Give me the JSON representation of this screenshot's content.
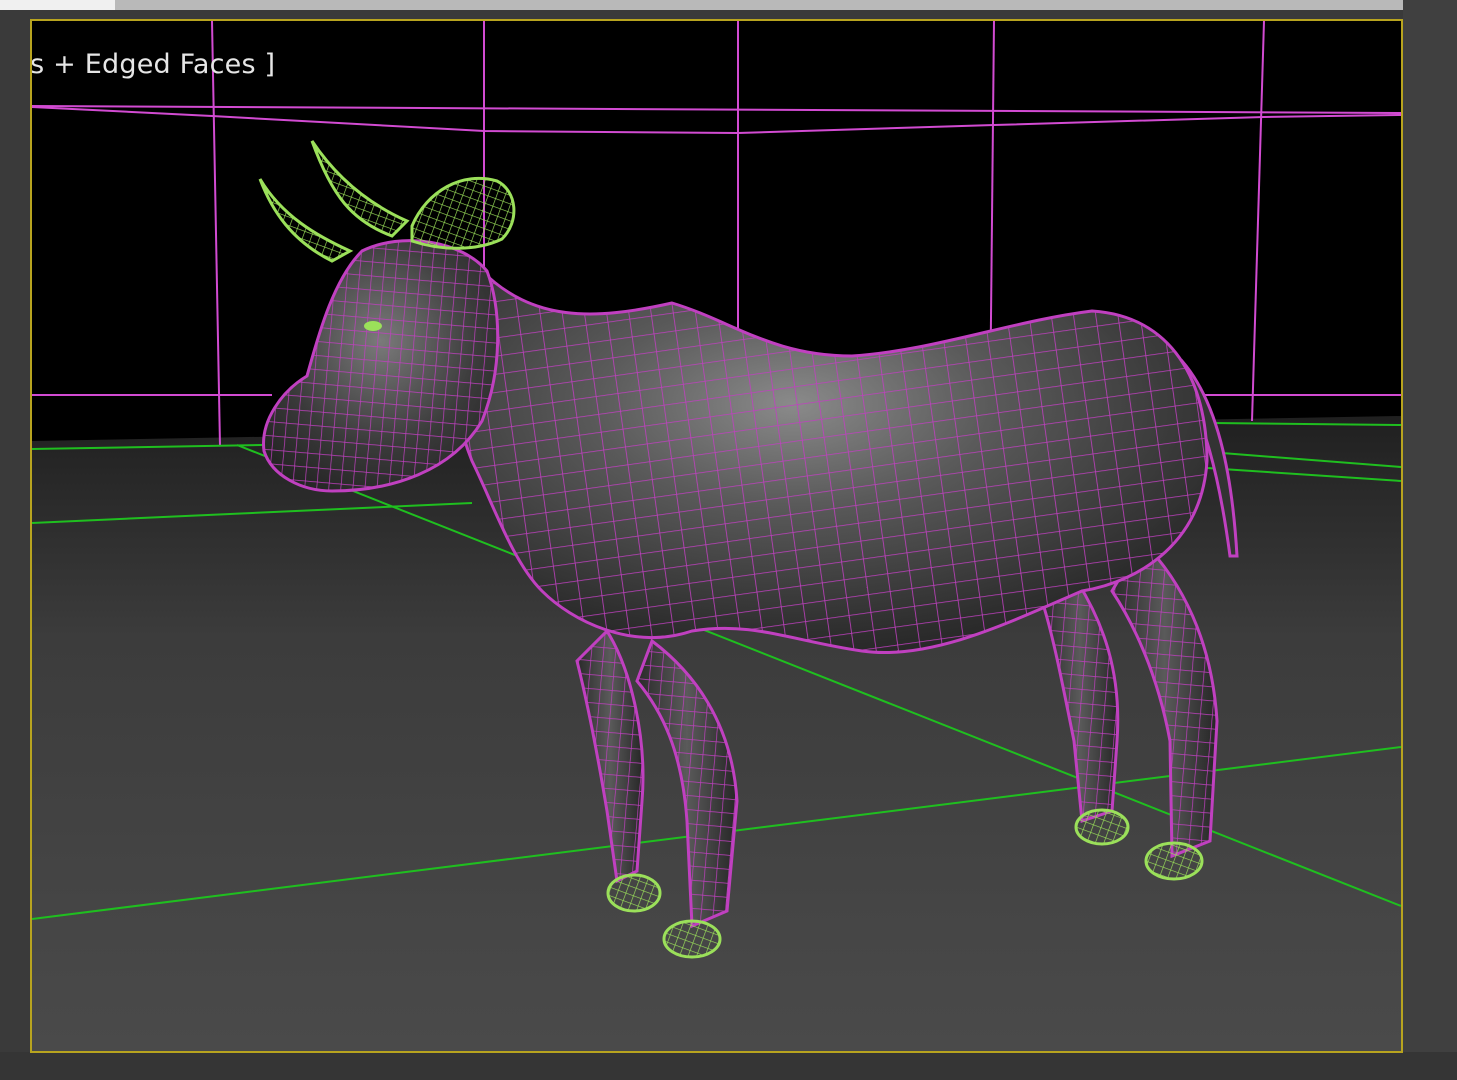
{
  "viewport": {
    "label": "hts + Edged Faces ]",
    "border_color": "#b8a41f",
    "grid_color": "#d24bd2",
    "ground_grid_color": "#1fbf1f",
    "mesh_color": "#c040c0",
    "accent_mesh_color": "#9be05a",
    "model_name": "cow-model"
  }
}
